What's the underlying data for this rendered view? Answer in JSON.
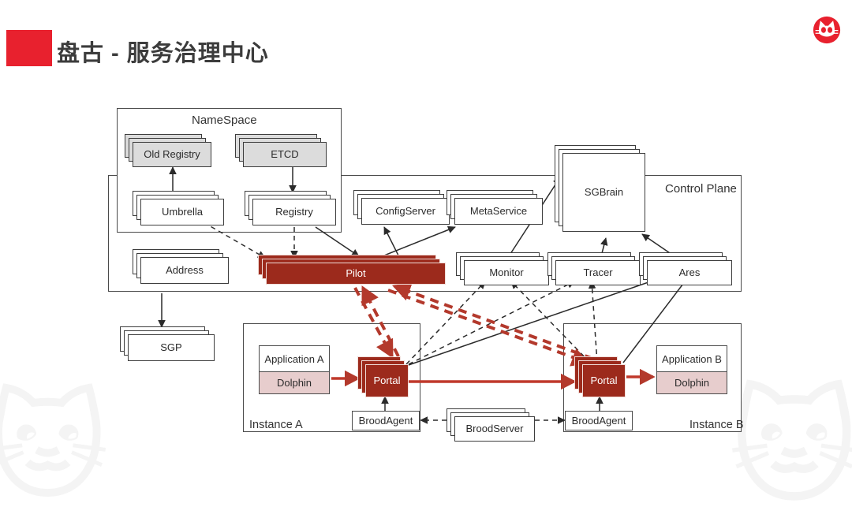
{
  "header": {
    "title": "盘古 - 服务治理中心",
    "accent_color": "#e8212e",
    "logo_name": "tmall-cat-logo"
  },
  "palette": {
    "node_fill": "#ffffff",
    "node_gray_fill": "#dcdcdc",
    "highlight_red": "#9c2a1c",
    "dolphin_pink": "#e7cdcd",
    "border": "#4a4a4a",
    "red_arrow": "#b3392c"
  },
  "containers": [
    {
      "key": "namespace",
      "label": "NameSpace",
      "label_pos": "top-center"
    },
    {
      "key": "control_plane",
      "label": "Control Plane",
      "label_pos": "top-right"
    },
    {
      "key": "instance_a",
      "label": "Instance A",
      "label_pos": "bottom-left"
    },
    {
      "key": "instance_b",
      "label": "Instance B",
      "label_pos": "bottom-right"
    }
  ],
  "nodes": {
    "old_registry": {
      "label": "Old Registry",
      "style": "gray",
      "stacked": true
    },
    "etcd": {
      "label": "ETCD",
      "style": "gray",
      "stacked": true
    },
    "umbrella": {
      "label": "Umbrella",
      "style": "white",
      "stacked": true
    },
    "registry": {
      "label": "Registry",
      "style": "white",
      "stacked": true
    },
    "address": {
      "label": "Address",
      "style": "white",
      "stacked": true
    },
    "sgp": {
      "label": "SGP",
      "style": "white",
      "stacked": true
    },
    "configserver": {
      "label": "ConfigServer",
      "style": "white",
      "stacked": true
    },
    "metaservice": {
      "label": "MetaService",
      "style": "white",
      "stacked": true
    },
    "sgbrain": {
      "label": "SGBrain",
      "style": "white",
      "stacked": true
    },
    "pilot": {
      "label": "Pilot",
      "style": "red",
      "stacked": true
    },
    "monitor": {
      "label": "Monitor",
      "style": "white",
      "stacked": true
    },
    "tracer": {
      "label": "Tracer",
      "style": "white",
      "stacked": true
    },
    "ares": {
      "label": "Ares",
      "style": "white",
      "stacked": true
    },
    "portal_a": {
      "label": "Portal",
      "style": "red",
      "stacked": true
    },
    "portal_b": {
      "label": "Portal",
      "style": "red",
      "stacked": true
    },
    "application_a": {
      "label": "Application A",
      "sub_label": "Dolphin",
      "style": "app"
    },
    "application_b": {
      "label": "Application B",
      "sub_label": "Dolphin",
      "style": "app"
    },
    "broodagent_a": {
      "label": "BroodAgent",
      "style": "plain"
    },
    "broodagent_b": {
      "label": "BroodAgent",
      "style": "plain"
    },
    "broodserver": {
      "label": "BroodServer",
      "style": "white",
      "stacked": true
    }
  },
  "edges": [
    {
      "from": "umbrella",
      "to": "old_registry",
      "kind": "solid-black"
    },
    {
      "from": "etcd",
      "to": "registry",
      "kind": "solid-black"
    },
    {
      "from": "umbrella",
      "to": "pilot",
      "kind": "dashed-black"
    },
    {
      "from": "registry",
      "to": "pilot",
      "kind": "dashed-black"
    },
    {
      "from": "registry",
      "to": "pilot",
      "kind": "solid-black"
    },
    {
      "from": "address",
      "to": "sgp",
      "kind": "solid-black"
    },
    {
      "from": "pilot",
      "to": "configserver",
      "kind": "solid-black"
    },
    {
      "from": "pilot",
      "to": "metaservice",
      "kind": "solid-black"
    },
    {
      "from": "monitor",
      "to": "sgbrain",
      "kind": "solid-black"
    },
    {
      "from": "tracer",
      "to": "sgbrain",
      "kind": "solid-black"
    },
    {
      "from": "ares",
      "to": "sgbrain",
      "kind": "solid-black"
    },
    {
      "from": "pilot",
      "to": "portal_a",
      "kind": "dashed-red"
    },
    {
      "from": "portal_a",
      "to": "pilot",
      "kind": "dashed-red"
    },
    {
      "from": "pilot",
      "to": "portal_b",
      "kind": "dashed-red"
    },
    {
      "from": "portal_b",
      "to": "pilot",
      "kind": "dashed-red"
    },
    {
      "from": "portal_a",
      "to": "monitor",
      "kind": "dashed-black"
    },
    {
      "from": "portal_a",
      "to": "tracer",
      "kind": "dashed-black"
    },
    {
      "from": "portal_a",
      "to": "ares",
      "kind": "solid-black"
    },
    {
      "from": "portal_b",
      "to": "monitor",
      "kind": "dashed-black"
    },
    {
      "from": "portal_b",
      "to": "tracer",
      "kind": "dashed-black"
    },
    {
      "from": "portal_b",
      "to": "ares",
      "kind": "solid-black"
    },
    {
      "from": "application_a",
      "to": "portal_a",
      "kind": "solid-red"
    },
    {
      "from": "portal_a",
      "to": "portal_b",
      "kind": "solid-red"
    },
    {
      "from": "portal_b",
      "to": "application_b",
      "kind": "solid-red"
    },
    {
      "from": "broodagent_a",
      "to": "portal_a",
      "kind": "solid-black"
    },
    {
      "from": "broodagent_b",
      "to": "portal_b",
      "kind": "solid-black"
    },
    {
      "from": "broodserver",
      "to": "broodagent_a",
      "kind": "dashed-black"
    },
    {
      "from": "broodserver",
      "to": "broodagent_b",
      "kind": "dashed-black"
    }
  ]
}
